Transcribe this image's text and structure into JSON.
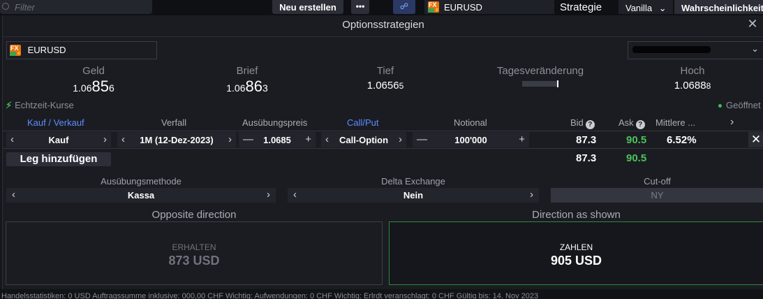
{
  "background": {
    "filter_placeholder": "Filter",
    "new_button": "Neu erstellen",
    "more_button": "•••",
    "link_icon": "link-icon",
    "symbol": "EURUSD",
    "strategy_label": "Strategie",
    "strategy_value": "Vanilla",
    "probability_button": "Wahrscheinlichkeit",
    "status_bar": "Handelsstatistiken: 0 USD  Auftragssumme inklusive: 000,00 CHF  Wichtig: Aufwendungen: 0 CHF  Wichtig: Erlrdt veranschlagt: 0 CHF  Gültig bis: 14. Nov 2023"
  },
  "dialog": {
    "title": "Optionsstrategien",
    "close_icon": "close-icon",
    "instrument": "EURUSD",
    "instrument_logo_badge": "c",
    "account_chevron": "⌵"
  },
  "quotes": {
    "geld": {
      "label": "Geld",
      "pre": "1.06",
      "big": "85",
      "post": "6"
    },
    "brief": {
      "label": "Brief",
      "pre": "1.06",
      "big": "86",
      "post": "3"
    },
    "tief": {
      "label": "Tief",
      "pre": "1.0656",
      "post": "5"
    },
    "tagesveraenderung": {
      "label": "Tagesveränderung"
    },
    "hoch": {
      "label": "Hoch",
      "pre": "1.0688",
      "post": "8"
    }
  },
  "status": {
    "live_prices": "Echtzeit-Kurse",
    "market_state": "Geöffnet"
  },
  "columns": {
    "direction": "Kauf / Verkauf",
    "expiry": "Verfall",
    "strike": "Ausübungspreis",
    "call_put": "Call/Put",
    "notional": "Notional",
    "bid": "Bid",
    "ask": "Ask",
    "mid": "Mittlere ..."
  },
  "leg": {
    "direction": "Kauf",
    "expiry": "1M (12-Dez-2023)",
    "strike": "1.0685",
    "call_put": "Call-Option",
    "notional": "100'000",
    "bid": "87.3",
    "ask": "90.5",
    "mid": "6.52%"
  },
  "totals": {
    "bid": "87.3",
    "ask": "90.5"
  },
  "add_leg_button": "Leg hinzufügen",
  "settings": {
    "exercise_label": "Ausübungsmethode",
    "exercise_value": "Kassa",
    "delta_label": "Delta Exchange",
    "delta_value": "Nein",
    "cutoff_label": "Cut-off",
    "cutoff_value": "NY"
  },
  "directions": {
    "opposite_label": "Opposite direction",
    "opposite_action": "ERHALTEN",
    "opposite_amount": "873 USD",
    "shown_label": "Direction as shown",
    "shown_action": "ZAHLEN",
    "shown_amount": "905 USD"
  },
  "colors": {
    "accent_blue": "#5b8dff",
    "positive_green": "#4cc35a",
    "pay_border": "#2c8a3a",
    "background": "#1b1c22"
  }
}
